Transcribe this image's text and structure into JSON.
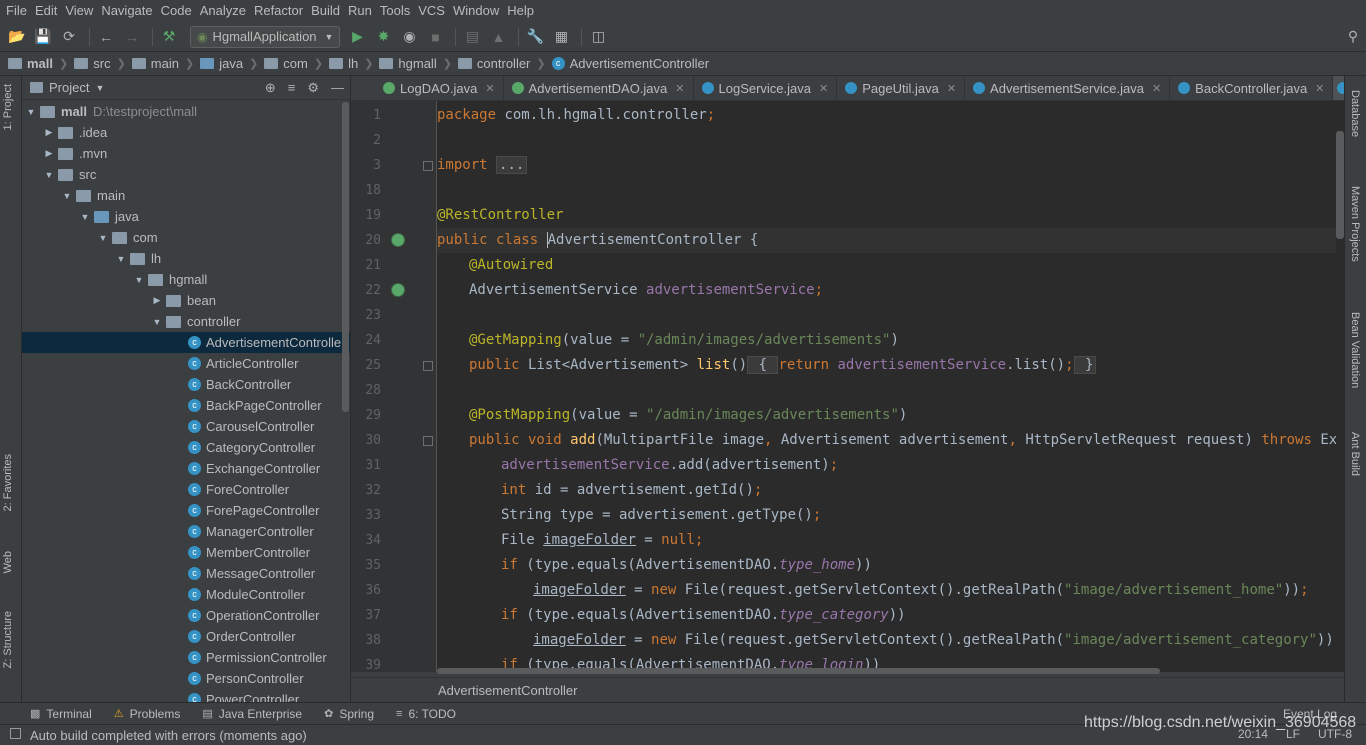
{
  "menu": [
    "File",
    "Edit",
    "View",
    "Navigate",
    "Code",
    "Analyze",
    "Refactor",
    "Build",
    "Run",
    "Tools",
    "VCS",
    "Window",
    "Help"
  ],
  "toolbar": {
    "run_config": "HgmallApplication"
  },
  "breadcrumb": [
    "mall",
    "src",
    "main",
    "java",
    "com",
    "lh",
    "hgmall",
    "controller",
    "AdvertisementController"
  ],
  "left_strip": {
    "project": "1: Project",
    "favorites": "2: Favorites",
    "web": "Web",
    "structure": "Z: Structure"
  },
  "right_strip": {
    "database": "Database",
    "maven": "Maven Projects",
    "bean": "Bean Validation",
    "ant": "Ant Build"
  },
  "project_panel": {
    "title": "Project",
    "root_name": "mall",
    "root_path": "D:\\testproject\\mall",
    "folders": {
      "idea": ".idea",
      "mvn": ".mvn",
      "src": "src",
      "main": "main",
      "java": "java",
      "com": "com",
      "lh": "lh",
      "hgmall": "hgmall",
      "bean": "bean",
      "controller": "controller"
    },
    "classes": [
      "AdvertisementController",
      "ArticleController",
      "BackController",
      "BackPageController",
      "CarouselController",
      "CategoryController",
      "ExchangeController",
      "ForeController",
      "ForePageController",
      "ManagerController",
      "MemberController",
      "MessageController",
      "ModuleController",
      "OperationController",
      "OrderController",
      "PermissionController",
      "PersonController",
      "PowerController"
    ]
  },
  "editor_tabs": [
    "LogDAO.java",
    "AdvertisementDAO.java",
    "LogService.java",
    "PageUtil.java",
    "AdvertisementService.java",
    "BackController.java"
  ],
  "line_numbers": [
    "1",
    "2",
    "3",
    "18",
    "19",
    "20",
    "21",
    "22",
    "23",
    "24",
    "25",
    "28",
    "29",
    "30",
    "31",
    "32",
    "33",
    "34",
    "35",
    "36",
    "37",
    "38",
    "39"
  ],
  "code": {
    "l1": {
      "k": "package",
      "rest": " com.lh.hgmall.controller",
      "semi": ";"
    },
    "l3": {
      "k": "import",
      "fold": "..."
    },
    "l19": {
      "a": "@RestController"
    },
    "l20": {
      "k": "public class",
      "name": "AdvertisementController",
      "rest": " {"
    },
    "l21": {
      "a": "@Autowired"
    },
    "l22": {
      "type": "AdvertisementService ",
      "field": "advertisementService",
      "semi": ";"
    },
    "l24": {
      "a": "@GetMapping",
      "p1": "(value = ",
      "s": "\"/admin/images/advertisements\"",
      "p2": ")"
    },
    "l25": {
      "k": "public",
      "t": " List<Advertisement> ",
      "m": "list",
      "p": "()",
      "fold1": " { ",
      "k2": "return",
      "f": " advertisementService",
      "rest": ".list()",
      "semi": ";",
      "fold2": " }"
    },
    "l29": {
      "a": "@PostMapping",
      "p1": "(value = ",
      "s": "\"/admin/images/advertisements\"",
      "p2": ")"
    },
    "l30": {
      "k": "public void",
      "m": " add",
      "p": "(MultipartFile image",
      "c1": ",",
      "p2": " Advertisement advertisement",
      "c2": ",",
      "p3": " HttpServletRequest request) ",
      "k2": "throws",
      "rest": " Exception"
    },
    "l31": {
      "f": "advertisementService",
      "rest": ".add(advertisement)",
      "semi": ";"
    },
    "l32": {
      "k": "int",
      "rest": " id = advertisement.getId()",
      "semi": ";"
    },
    "l33": {
      "rest": "String type = advertisement.getType()",
      "semi": ";"
    },
    "l34": {
      "t": "File ",
      "u": "imageFolder",
      "eq": " = ",
      "k": "null",
      "semi": ";"
    },
    "l35": {
      "k": "if",
      "p": " (type.equals(AdvertisementDAO.",
      "fi": "type_home",
      "end": "))"
    },
    "l36": {
      "u": "imageFolder",
      "eq": " = ",
      "k": "new",
      "p": " File(request.getServletContext().getRealPath(",
      "s": "\"image/advertisement_home\"",
      "end": "))",
      "semi": ";"
    },
    "l37": {
      "k": "if",
      "p": " (type.equals(AdvertisementDAO.",
      "fi": "type_category",
      "end": "))"
    },
    "l38": {
      "u": "imageFolder",
      "eq": " = ",
      "k": "new",
      "p": " File(request.getServletContext().getRealPath(",
      "s": "\"image/advertisement_category\"",
      "end": "))",
      "semi": ";"
    },
    "l39": {
      "k": "if",
      "p": " (type.equals(AdvertisementDAO.",
      "fi": "type_login",
      "end": "))"
    }
  },
  "editor_breadcrumb": "AdvertisementController",
  "tool_tabs": {
    "terminal": "Terminal",
    "problems": "Problems",
    "java_enterprise": "Java Enterprise",
    "spring": "Spring",
    "todo": "6: TODO"
  },
  "status": {
    "message": "Auto build completed with errors (moments ago)",
    "position": "20:14",
    "line_sep": "LF",
    "encoding": "UTF-8",
    "event_log": "Event Log"
  },
  "watermark": "https://blog.csdn.net/weixin_36904568"
}
